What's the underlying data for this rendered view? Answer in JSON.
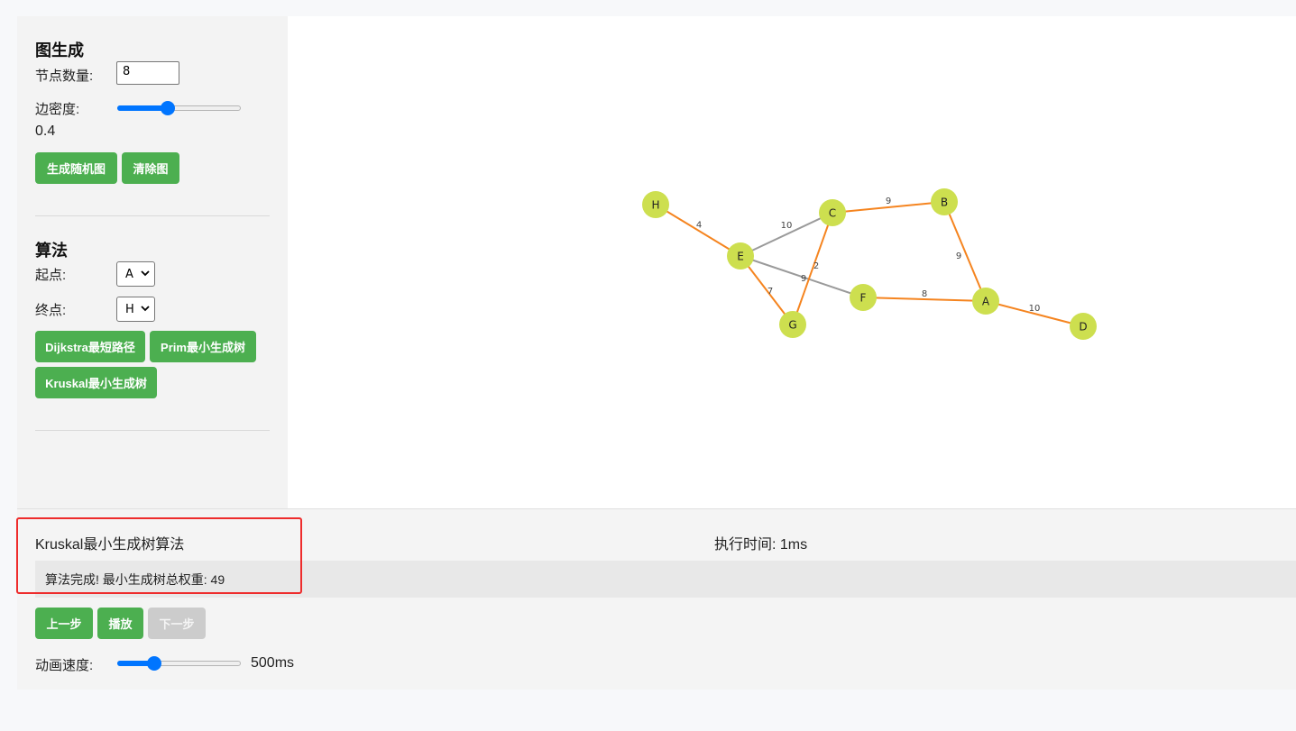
{
  "sidebar": {
    "graph_section_title": "图生成",
    "node_count_label": "节点数量:",
    "node_count_value": "8",
    "edge_density_label": "边密度:",
    "edge_density_value": "0.4",
    "edge_density_fraction": 0.4,
    "generate_button": "生成随机图",
    "clear_button": "清除图",
    "algo_section_title": "算法",
    "start_label": "起点:",
    "start_value": "A",
    "end_label": "终点:",
    "end_value": "H",
    "dijkstra_button": "Dijkstra最短路径",
    "prim_button": "Prim最小生成树",
    "kruskal_button": "Kruskal最小生成树"
  },
  "bottom": {
    "algorithm_name": "Kruskal最小生成树算法",
    "exec_time": "执行时间: 1ms",
    "status_message": "算法完成! 最小生成树总权重: 49",
    "prev_button": "上一步",
    "play_button": "播放",
    "next_button": "下一步",
    "speed_label": "动画速度:",
    "speed_value": "500ms",
    "speed_fraction": 0.27
  },
  "graph": {
    "colors": {
      "node_fill": "#cddf4f",
      "mst_edge": "#f5841f",
      "normal_edge": "#9a9a9a",
      "accent_green": "#4caf50",
      "highlight_red": "#ee2c2c"
    },
    "nodes": [
      {
        "id": "H",
        "label": "H"
      },
      {
        "id": "C",
        "label": "C"
      },
      {
        "id": "B",
        "label": "B"
      },
      {
        "id": "E",
        "label": "E"
      },
      {
        "id": "F",
        "label": "F"
      },
      {
        "id": "A",
        "label": "A"
      },
      {
        "id": "G",
        "label": "G"
      },
      {
        "id": "D",
        "label": "D"
      }
    ],
    "edges": [
      {
        "from": "H",
        "to": "E",
        "weight": "4",
        "in_mst": true
      },
      {
        "from": "E",
        "to": "C",
        "weight": "10",
        "in_mst": false
      },
      {
        "from": "C",
        "to": "B",
        "weight": "9",
        "in_mst": true
      },
      {
        "from": "B",
        "to": "A",
        "weight": "9",
        "in_mst": true
      },
      {
        "from": "E",
        "to": "F",
        "weight": "9",
        "in_mst": false
      },
      {
        "from": "C",
        "to": "G",
        "weight": "2",
        "in_mst": true
      },
      {
        "from": "E",
        "to": "G",
        "weight": "7",
        "in_mst": true
      },
      {
        "from": "F",
        "to": "A",
        "weight": "8",
        "in_mst": true
      },
      {
        "from": "A",
        "to": "D",
        "weight": "10",
        "in_mst": true
      }
    ]
  }
}
